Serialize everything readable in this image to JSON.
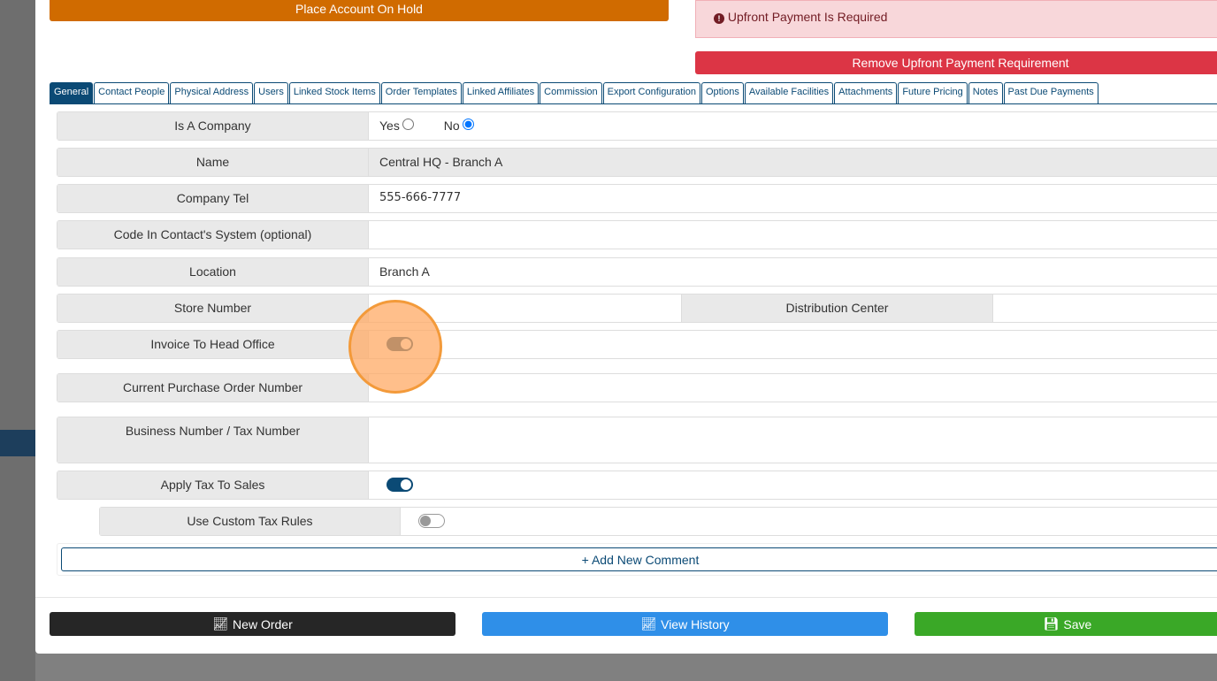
{
  "buttons": {
    "hold": "Place Account On Hold",
    "remove_upfront": "Remove Upfront Payment Requirement",
    "new_order": "New Order",
    "view_history": "View History",
    "save": "Save",
    "add_comment": "+ Add New Comment"
  },
  "alert": {
    "text": "Upfront Payment Is Required"
  },
  "tabs": [
    "General",
    "Contact People",
    "Physical Address",
    "Users",
    "Linked Stock Items",
    "Order Templates",
    "Linked Affiliates",
    "Commission",
    "Export Configuration",
    "Options",
    "Available Facilities",
    "Attachments",
    "Future Pricing",
    "Notes",
    "Past Due Payments"
  ],
  "fields": {
    "is_company": {
      "label": "Is A Company",
      "yes": "Yes",
      "no": "No",
      "value": "No"
    },
    "name": {
      "label": "Name",
      "value": "Central HQ - Branch A"
    },
    "tel": {
      "label": "Company Tel",
      "value": "555-666-7777"
    },
    "code": {
      "label": "Code In Contact's System (optional)",
      "value": ""
    },
    "location": {
      "label": "Location",
      "value": "Branch A"
    },
    "store": {
      "label": "Store Number",
      "value": ""
    },
    "dc": {
      "label": "Distribution Center",
      "value": ""
    },
    "invoice_head": {
      "label": "Invoice To Head Office",
      "on": true
    },
    "po": {
      "label": "Current Purchase Order Number",
      "value": ""
    },
    "bn": {
      "label": "Business Number / Tax Number",
      "value": ""
    },
    "apply_tax": {
      "label": "Apply Tax To Sales",
      "on": true
    },
    "custom_tax": {
      "label": "Use Custom Tax Rules",
      "on": false
    }
  },
  "colors": {
    "hold": "#d06b00",
    "danger": "#dc3545",
    "dark": "#262626",
    "info": "#2f8fe8",
    "success": "#3aa827",
    "primary": "#0b4a75"
  }
}
